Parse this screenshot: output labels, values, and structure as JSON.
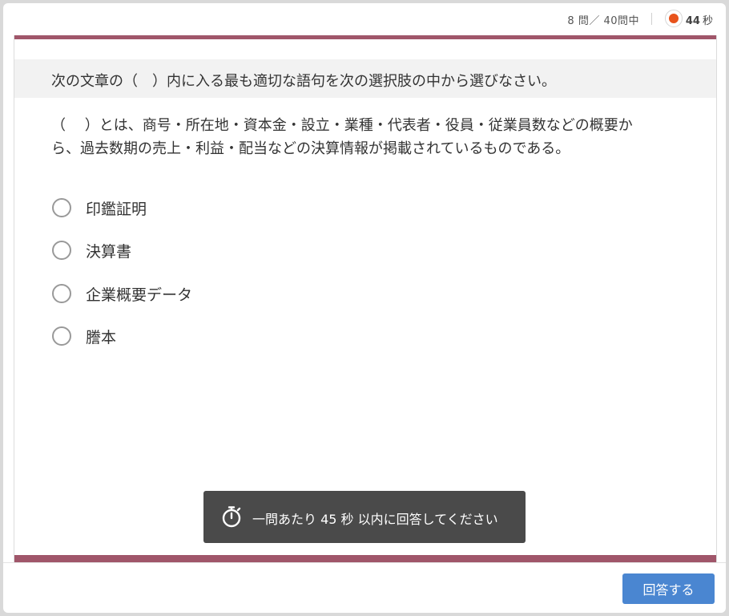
{
  "header": {
    "progress_text": "8 問／ 40問中",
    "timer_value": "44",
    "timer_unit": "秒",
    "timer_icon": "countdown-icon",
    "timer_color": "#e8531c"
  },
  "quiz": {
    "instruction": "次の文章の（　）内に入る最も適切な語句を次の選択肢の中から選びなさい。",
    "question_line1": "（　 ）とは、商号・所在地・資本金・設立・業種・代表者・役員・従業員数などの概要か",
    "question_line2": "ら、過去数期の売上・利益・配当などの決算情報が掲載されているものである。",
    "options": [
      {
        "label": "印鑑証明"
      },
      {
        "label": "決算書"
      },
      {
        "label": "企業概要データ"
      },
      {
        "label": "謄本"
      }
    ]
  },
  "notice": {
    "icon": "stopwatch-icon",
    "text": "一問あたり 45 秒 以内に回答してください"
  },
  "footer": {
    "submit_label": "回答する",
    "submit_color": "#4a86d1"
  },
  "theme": {
    "accent_bar": "#a0566a"
  }
}
